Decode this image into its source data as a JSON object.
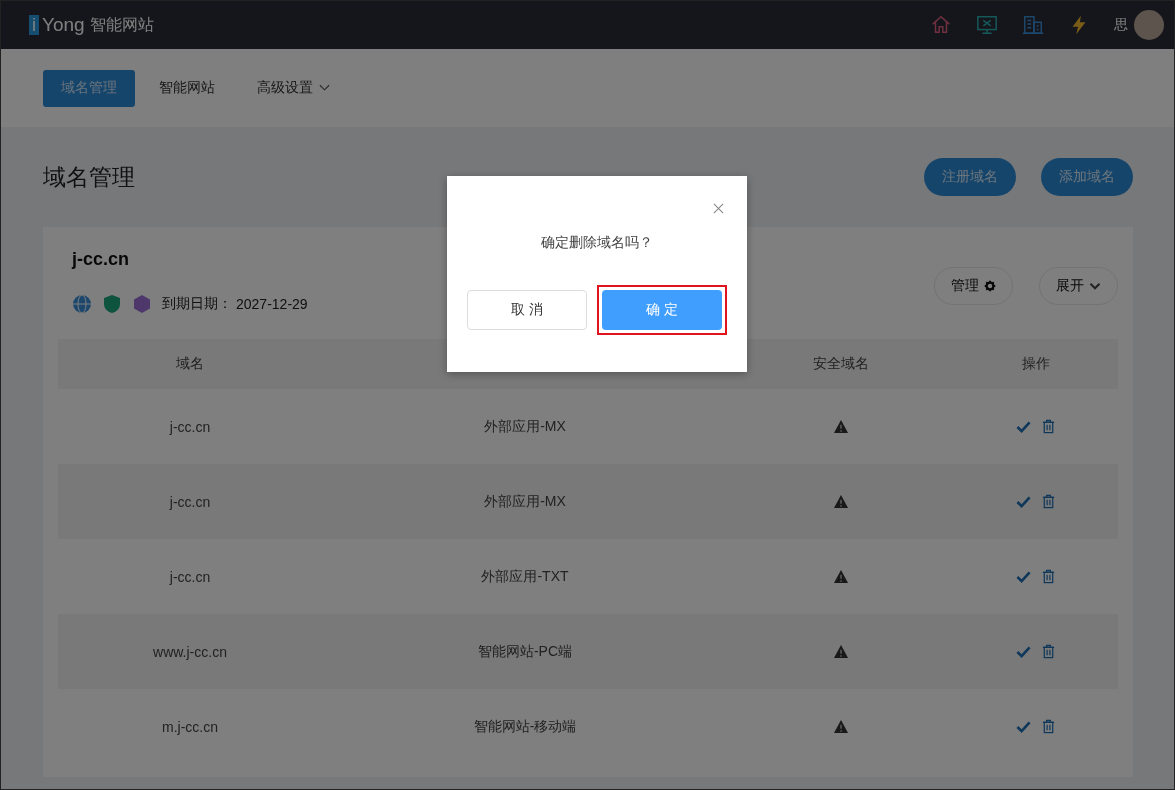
{
  "header": {
    "logo_mark": "i",
    "logo_text": "Yong",
    "product": "智能网站",
    "user_name": "思"
  },
  "nav": [
    {
      "label": "域名管理",
      "selected": true,
      "dropdown": false
    },
    {
      "label": "智能网站",
      "selected": false,
      "dropdown": false
    },
    {
      "label": "高级设置",
      "selected": false,
      "dropdown": true
    }
  ],
  "page": {
    "title": "域名管理",
    "buttons": [
      "注册域名",
      "添加域名"
    ]
  },
  "domain_card": {
    "name": "j-cc.cn",
    "expiry_label": "到期日期：",
    "expiry_date": "2027-12-29",
    "manage_button": "管理",
    "expand_button": "展开",
    "table": {
      "columns": [
        "域名",
        null,
        "安全域名",
        "操作"
      ],
      "rows": [
        {
          "domain": "j-cc.cn",
          "record": "外部应用-MX"
        },
        {
          "domain": "j-cc.cn",
          "record": "外部应用-MX"
        },
        {
          "domain": "j-cc.cn",
          "record": "外部应用-TXT"
        },
        {
          "domain": "www.j-cc.cn",
          "record": "智能网站-PC端"
        },
        {
          "domain": "m.j-cc.cn",
          "record": "智能网站-移动端"
        }
      ]
    }
  },
  "dialog": {
    "message": "确定删除域名吗？",
    "cancel": "取 消",
    "confirm": "确 定"
  }
}
